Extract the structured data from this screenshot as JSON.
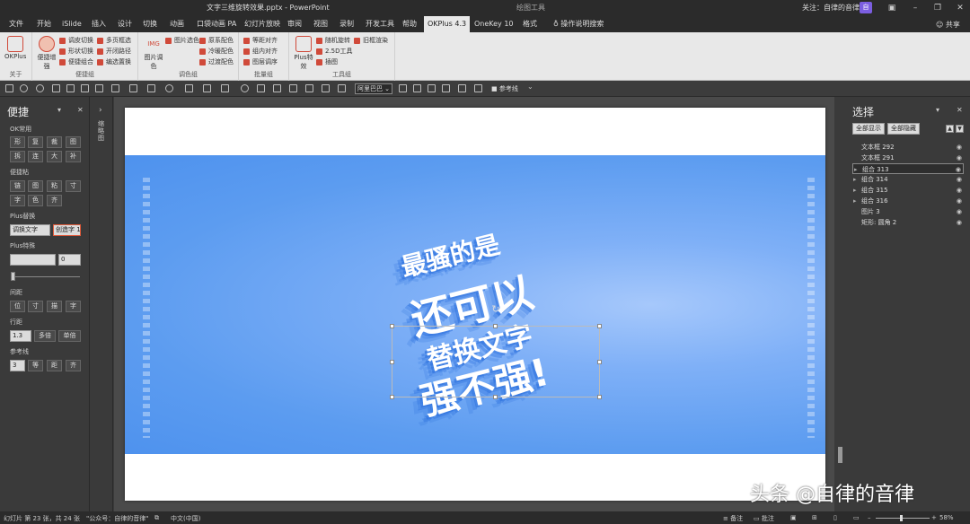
{
  "titlebar": {
    "document_title": "文字三维旋转效果.pptx - PowerPoint",
    "context_label": "绘图工具",
    "follow_text": "关注：自律的音律",
    "avatar": "自"
  },
  "menu": {
    "tabs": [
      {
        "label": "文件"
      },
      {
        "label": "开始"
      },
      {
        "label": "iSlide"
      },
      {
        "label": "插入"
      },
      {
        "label": "设计"
      },
      {
        "label": "切换"
      },
      {
        "label": "动画"
      },
      {
        "label": "口袋动画 PA"
      },
      {
        "label": "幻灯片放映"
      },
      {
        "label": "审阅"
      },
      {
        "label": "视图"
      },
      {
        "label": "录制"
      },
      {
        "label": "开发工具"
      },
      {
        "label": "帮助"
      },
      {
        "label": "OKPlus 4.3"
      },
      {
        "label": "OneKey 10"
      },
      {
        "label": "格式"
      }
    ],
    "search_label": "操作说明搜索",
    "share_label": "共享"
  },
  "ribbon": {
    "groups": [
      {
        "label": "关于",
        "big": [
          "OKPlus"
        ]
      },
      {
        "label": "便捷组",
        "big": [
          "便捷增强"
        ],
        "small": [
          "调皮切换",
          "形状切换",
          "便捷组合",
          "多页框选",
          "开闭路径",
          "编选置换"
        ]
      },
      {
        "label": "调色组",
        "big": [
          "图片调色"
        ],
        "small": [
          "图片选色",
          "原系配色",
          "冷暖配色",
          "过渡配色"
        ]
      },
      {
        "label": "批量组",
        "small": [
          "等距对齐",
          "组内对齐",
          "图层调序"
        ]
      },
      {
        "label": "工具组",
        "big": [
          "Plus特效"
        ],
        "small": [
          "随机旋转",
          "2.5D工具",
          "插图",
          "旧框渲染"
        ]
      }
    ]
  },
  "toolbar": {
    "select_value": "阿里巴巴",
    "checkbox_label": "参考线"
  },
  "left_panel": {
    "title": "便捷",
    "sections": {
      "ok_common": "OK常用",
      "ok_buttons": [
        "形",
        "复",
        "裁",
        "图",
        "拆",
        "连",
        "大",
        "补"
      ],
      "convenience": "便捷粘",
      "conv_buttons": [
        "链",
        "图",
        "粘",
        "寸",
        "字",
        "色",
        "齐"
      ],
      "plus_replace": "Plus替换",
      "replace_input": "调换文字",
      "replace_input2": "创造字 1",
      "plus_special": "Plus特殊",
      "special_value": "0",
      "spacing": "间距",
      "spacing_buttons": [
        "位",
        "寸",
        "描",
        "字"
      ],
      "line_spacing": "行距",
      "line_value": "1.3",
      "line_buttons": [
        "多倍",
        "单倍"
      ],
      "guides": "参考线",
      "guide_value": "3",
      "guide_buttons": [
        "等",
        "距",
        "齐"
      ]
    }
  },
  "strip": {
    "label": "缩略图"
  },
  "slide": {
    "lines": [
      "最骚的是",
      "还可以",
      "替换文字",
      "强不强!"
    ]
  },
  "right_panel": {
    "title": "选择",
    "show_all": "全部显示",
    "hide_all": "全部隐藏",
    "items": [
      {
        "name": "文本框 292",
        "expand": false,
        "selected": false
      },
      {
        "name": "文本框 291",
        "expand": false,
        "selected": false
      },
      {
        "name": "组合 313",
        "expand": true,
        "selected": true
      },
      {
        "name": "组合 314",
        "expand": true,
        "selected": false
      },
      {
        "name": "组合 315",
        "expand": true,
        "selected": false
      },
      {
        "name": "组合 316",
        "expand": true,
        "selected": false
      },
      {
        "name": "图片 3",
        "expand": false,
        "selected": false
      },
      {
        "name": "矩形: 圆角 2",
        "expand": false,
        "selected": false
      }
    ]
  },
  "statusbar": {
    "slide_info": "幻灯片 第 23 张，共 24 张",
    "theme": "\"公众号：自律的音律\"",
    "language": "中文(中国)",
    "notes": "备注",
    "comments": "批注",
    "zoom": "58%"
  },
  "watermark": "头条 @自律的音律"
}
